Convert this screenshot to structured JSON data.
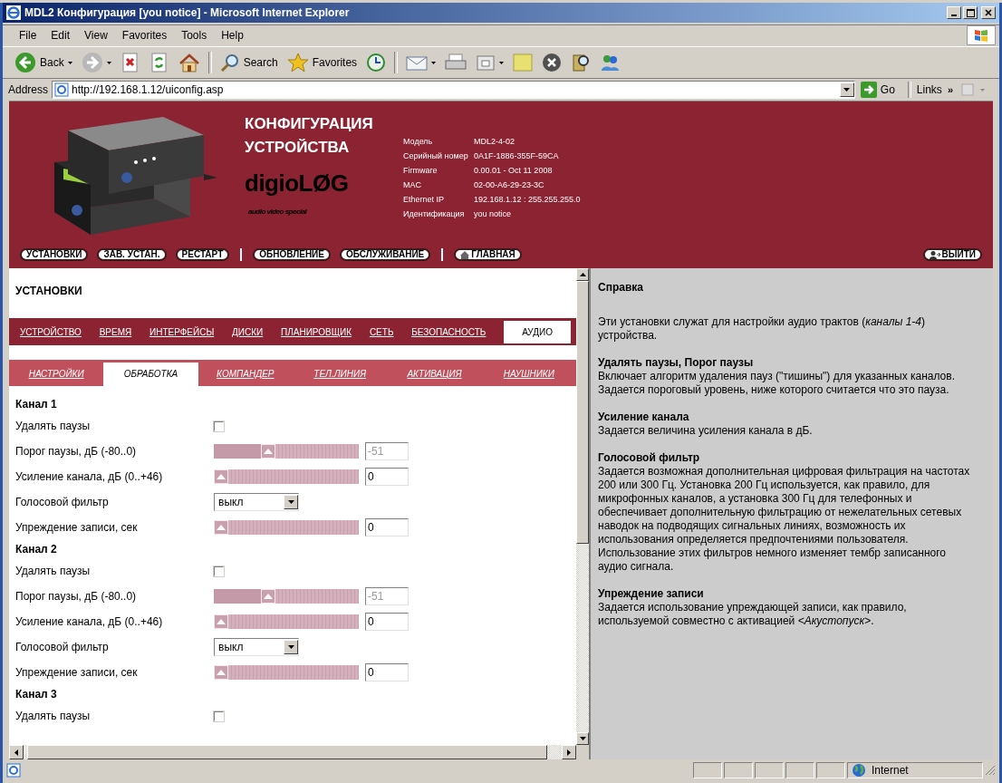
{
  "window": {
    "title": "MDL2 Конфигурация [you notice] - Microsoft Internet Explorer"
  },
  "menu": [
    {
      "label": "File"
    },
    {
      "label": "Edit"
    },
    {
      "label": "View"
    },
    {
      "label": "Favorites"
    },
    {
      "label": "Tools"
    },
    {
      "label": "Help"
    }
  ],
  "toolbar": {
    "back": "Back",
    "search": "Search",
    "favorites": "Favorites"
  },
  "address_bar": {
    "label": "Address",
    "value": "http://192.168.1.12/uiconfig.asp",
    "go": "Go",
    "links": "Links",
    "chevron": "»"
  },
  "header": {
    "title": "КОНФИГУРАЦИЯ УСТРОЙСТВА",
    "logo": "digioLØG",
    "tagline": "audio video special",
    "info": [
      {
        "label": "Модель",
        "value": "MDL2-4-02"
      },
      {
        "label": "Серийный номер",
        "value": "0A1F-1886-355F-59CA"
      },
      {
        "label": "Firmware",
        "value": "0.00.01 - Oct 11 2008"
      },
      {
        "label": "MAC",
        "value": "02-00-A6-29-23-3C"
      },
      {
        "label": "Ethernet IP",
        "value": "192.168.1.12 : 255.255.255.0"
      },
      {
        "label": "Идентификация",
        "value": "you notice"
      }
    ]
  },
  "nav": {
    "groups": [
      [
        {
          "label": "УСТАНОВКИ"
        },
        {
          "label": "ЗАВ. УСТАН."
        },
        {
          "label": "РЕСТАРТ"
        }
      ],
      [
        {
          "label": "ОБНОВЛЕНИЕ"
        },
        {
          "label": "ОБСЛУЖИВАНИЕ"
        }
      ]
    ],
    "home": {
      "label": "ГЛАВНАЯ"
    },
    "logout": {
      "label": "ВЫЙТИ"
    }
  },
  "section_title": "УСТАНОВКИ",
  "tabs": [
    {
      "label": "УСТРОЙСТВО",
      "selected": false
    },
    {
      "label": "ВРЕМЯ",
      "selected": false
    },
    {
      "label": "ИНТЕРФЕЙСЫ",
      "selected": false
    },
    {
      "label": "ДИСКИ",
      "selected": false
    },
    {
      "label": "ПЛАНИРОВЩИК",
      "selected": false
    },
    {
      "label": "СЕТЬ",
      "selected": false
    },
    {
      "label": "БЕЗОПАСНОСТЬ",
      "selected": false
    },
    {
      "label": "АУДИО",
      "selected": true
    }
  ],
  "subtabs": [
    {
      "label": "НАСТРОЙКИ",
      "selected": false
    },
    {
      "label": "ОБРАБОТКА",
      "selected": true
    },
    {
      "label": "КОМПАНДЕР",
      "selected": false
    },
    {
      "label": "ТЕЛ.ЛИНИЯ",
      "selected": false
    },
    {
      "label": "АКТИВАЦИЯ",
      "selected": false
    },
    {
      "label": "НАУШНИКИ",
      "selected": false
    }
  ],
  "channels": [
    {
      "title": "Канал 1",
      "rows": [
        {
          "kind": "checkbox",
          "label": "Удалять паузы",
          "checked": false
        },
        {
          "kind": "slider",
          "label": "Порог паузы, дБ (-80..0)",
          "level": 0.36,
          "value": "-51",
          "disabled": true
        },
        {
          "kind": "slider",
          "label": "Усиление канала, дБ (0..+46)",
          "level": 0,
          "value": "0",
          "disabled": false
        },
        {
          "kind": "select",
          "label": "Голосовой фильтр",
          "value": "выкл"
        },
        {
          "kind": "slider",
          "label": "Упреждение записи, сек",
          "level": 0,
          "value": "0",
          "disabled": false
        }
      ]
    },
    {
      "title": "Канал 2",
      "rows": [
        {
          "kind": "checkbox",
          "label": "Удалять паузы",
          "checked": false
        },
        {
          "kind": "slider",
          "label": "Порог паузы, дБ (-80..0)",
          "level": 0.36,
          "value": "-51",
          "disabled": true
        },
        {
          "kind": "slider",
          "label": "Усиление канала, дБ (0..+46)",
          "level": 0,
          "value": "0",
          "disabled": false
        },
        {
          "kind": "select",
          "label": "Голосовой фильтр",
          "value": "выкл"
        },
        {
          "kind": "slider",
          "label": "Упреждение записи, сек",
          "level": 0,
          "value": "0",
          "disabled": false
        }
      ]
    },
    {
      "title": "Канал 3",
      "rows": [
        {
          "kind": "checkbox",
          "label": "Удалять паузы",
          "checked": false
        }
      ]
    }
  ],
  "help": {
    "title": "Справка",
    "intro": "Эти установки служат для настройки аудио трактов (*каналы 1-4*) устройства.",
    "sections": [
      {
        "heading": "Удалять паузы, Порог паузы",
        "text": "Включает алгоритм удаления пауз (\"тишины\") для указанных каналов. Задается пороговый уровень, ниже которого считается что это пауза."
      },
      {
        "heading": "Усиление канала",
        "text": "Задается величина усиления канала в дБ."
      },
      {
        "heading": "Голосовой фильтр",
        "text": "Задается возможная дополнительная цифровая фильтрация на частотах 200 или 300 Гц. Установка 200 Гц используется, как правило, для микрофонных каналов, а установка 300 Гц для телефонных и обеспечивает дополнительную фильтрацию от нежелательных сетевых наводок на подводящих сигнальных линиях, возможность их использования определяется предпочтениями пользователя. Использование этих фильтров немного изменяет тембр записанного аудио сигнала."
      },
      {
        "heading": "Упреждение записи",
        "text": "Задается использование упреждающей записи, как правило, используемой совместно с активацией *<Акустопуск>*."
      }
    ]
  },
  "status_bar": {
    "zone": "Internet"
  }
}
